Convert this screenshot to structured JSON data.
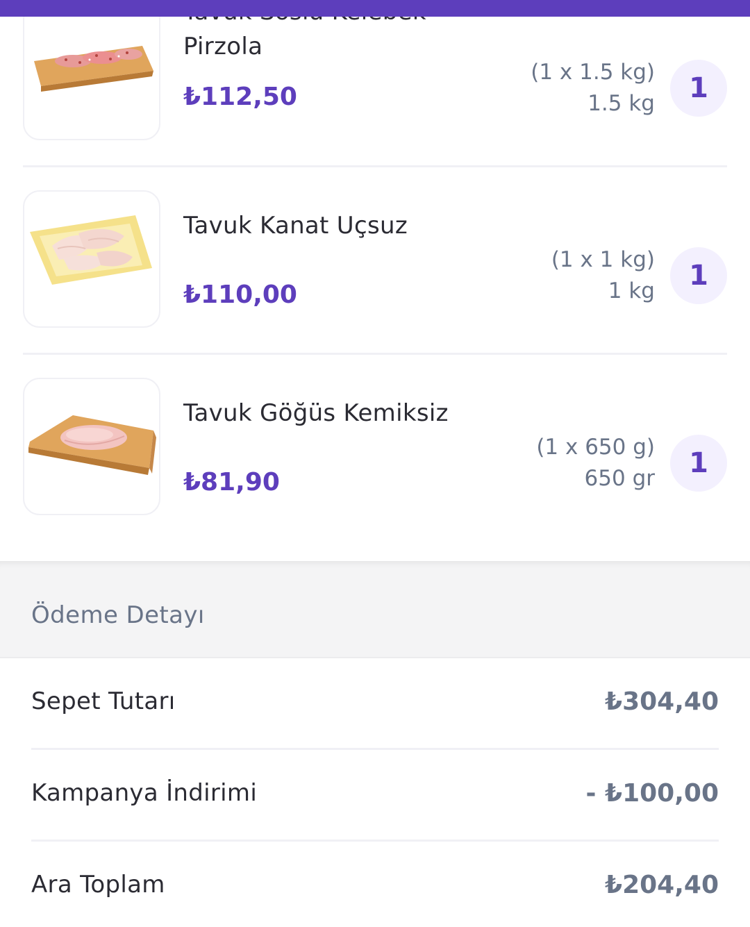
{
  "colors": {
    "brand": "#5d3ebc",
    "muted": "#697488",
    "badge_bg": "#f3f0fe"
  },
  "cart": {
    "items": [
      {
        "name": "Tavuk Soslu Kelebek Pirzola",
        "price": "₺112,50",
        "unit_detail": "(1 x 1.5 kg)",
        "amount": "1.5 kg",
        "quantity": "1",
        "image": "marinated-chicken-on-board"
      },
      {
        "name": "Tavuk Kanat Uçsuz",
        "price": "₺110,00",
        "unit_detail": "(1 x 1 kg)",
        "amount": "1 kg",
        "quantity": "1",
        "image": "chicken-wings-on-tray"
      },
      {
        "name": "Tavuk Göğüs Kemiksiz",
        "price": "₺81,90",
        "unit_detail": "(1 x 650 g)",
        "amount": "650 gr",
        "quantity": "1",
        "image": "chicken-breast-on-board"
      }
    ]
  },
  "payment": {
    "title": "Ödeme Detayı",
    "rows": [
      {
        "label": "Sepet Tutarı",
        "value": "₺304,40"
      },
      {
        "label": "Kampanya İndirimi",
        "value": "- ₺100,00"
      },
      {
        "label": "Ara Toplam",
        "value": "₺204,40"
      }
    ]
  }
}
